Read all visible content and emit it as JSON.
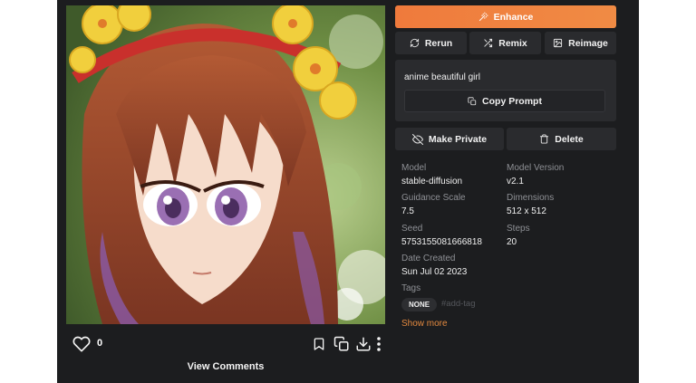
{
  "image": {
    "alt": "anime beautiful girl",
    "colors": {
      "hair": "#9b4a2c",
      "skin": "#f6dccb",
      "headband": "#c9302c",
      "flowers": "#f1cf3d",
      "eyes": "#9a6fb3"
    }
  },
  "actions": {
    "like_count": "0",
    "view_comments": "View Comments",
    "icons": [
      "heart-icon",
      "bookmark-icon",
      "copy-icon",
      "download-icon",
      "more-vertical-icon"
    ]
  },
  "buttons": {
    "enhance": "Enhance",
    "rerun": "Rerun",
    "remix": "Remix",
    "reimage": "Reimage",
    "copy_prompt": "Copy Prompt",
    "make_private": "Make Private",
    "delete": "Delete"
  },
  "prompt": "anime beautiful girl",
  "meta": {
    "model_label": "Model",
    "model_value": "stable-diffusion",
    "version_label": "Model Version",
    "version_value": "v2.1",
    "guidance_label": "Guidance Scale",
    "guidance_value": "7.5",
    "dimensions_label": "Dimensions",
    "dimensions_value": "512 x 512",
    "seed_label": "Seed",
    "seed_value": "5753155081666818",
    "steps_label": "Steps",
    "steps_value": "20",
    "date_label": "Date Created",
    "date_value": "Sun Jul 02 2023",
    "tags_label": "Tags"
  },
  "tags": {
    "none": "NONE",
    "add_placeholder": "#add-tag"
  },
  "show_more": "Show more",
  "colors": {
    "background": "#1c1d1f",
    "panel": "#2a2b2e",
    "accent": "#ef7a3c",
    "link": "#e3893f",
    "muted": "#8e9095"
  }
}
